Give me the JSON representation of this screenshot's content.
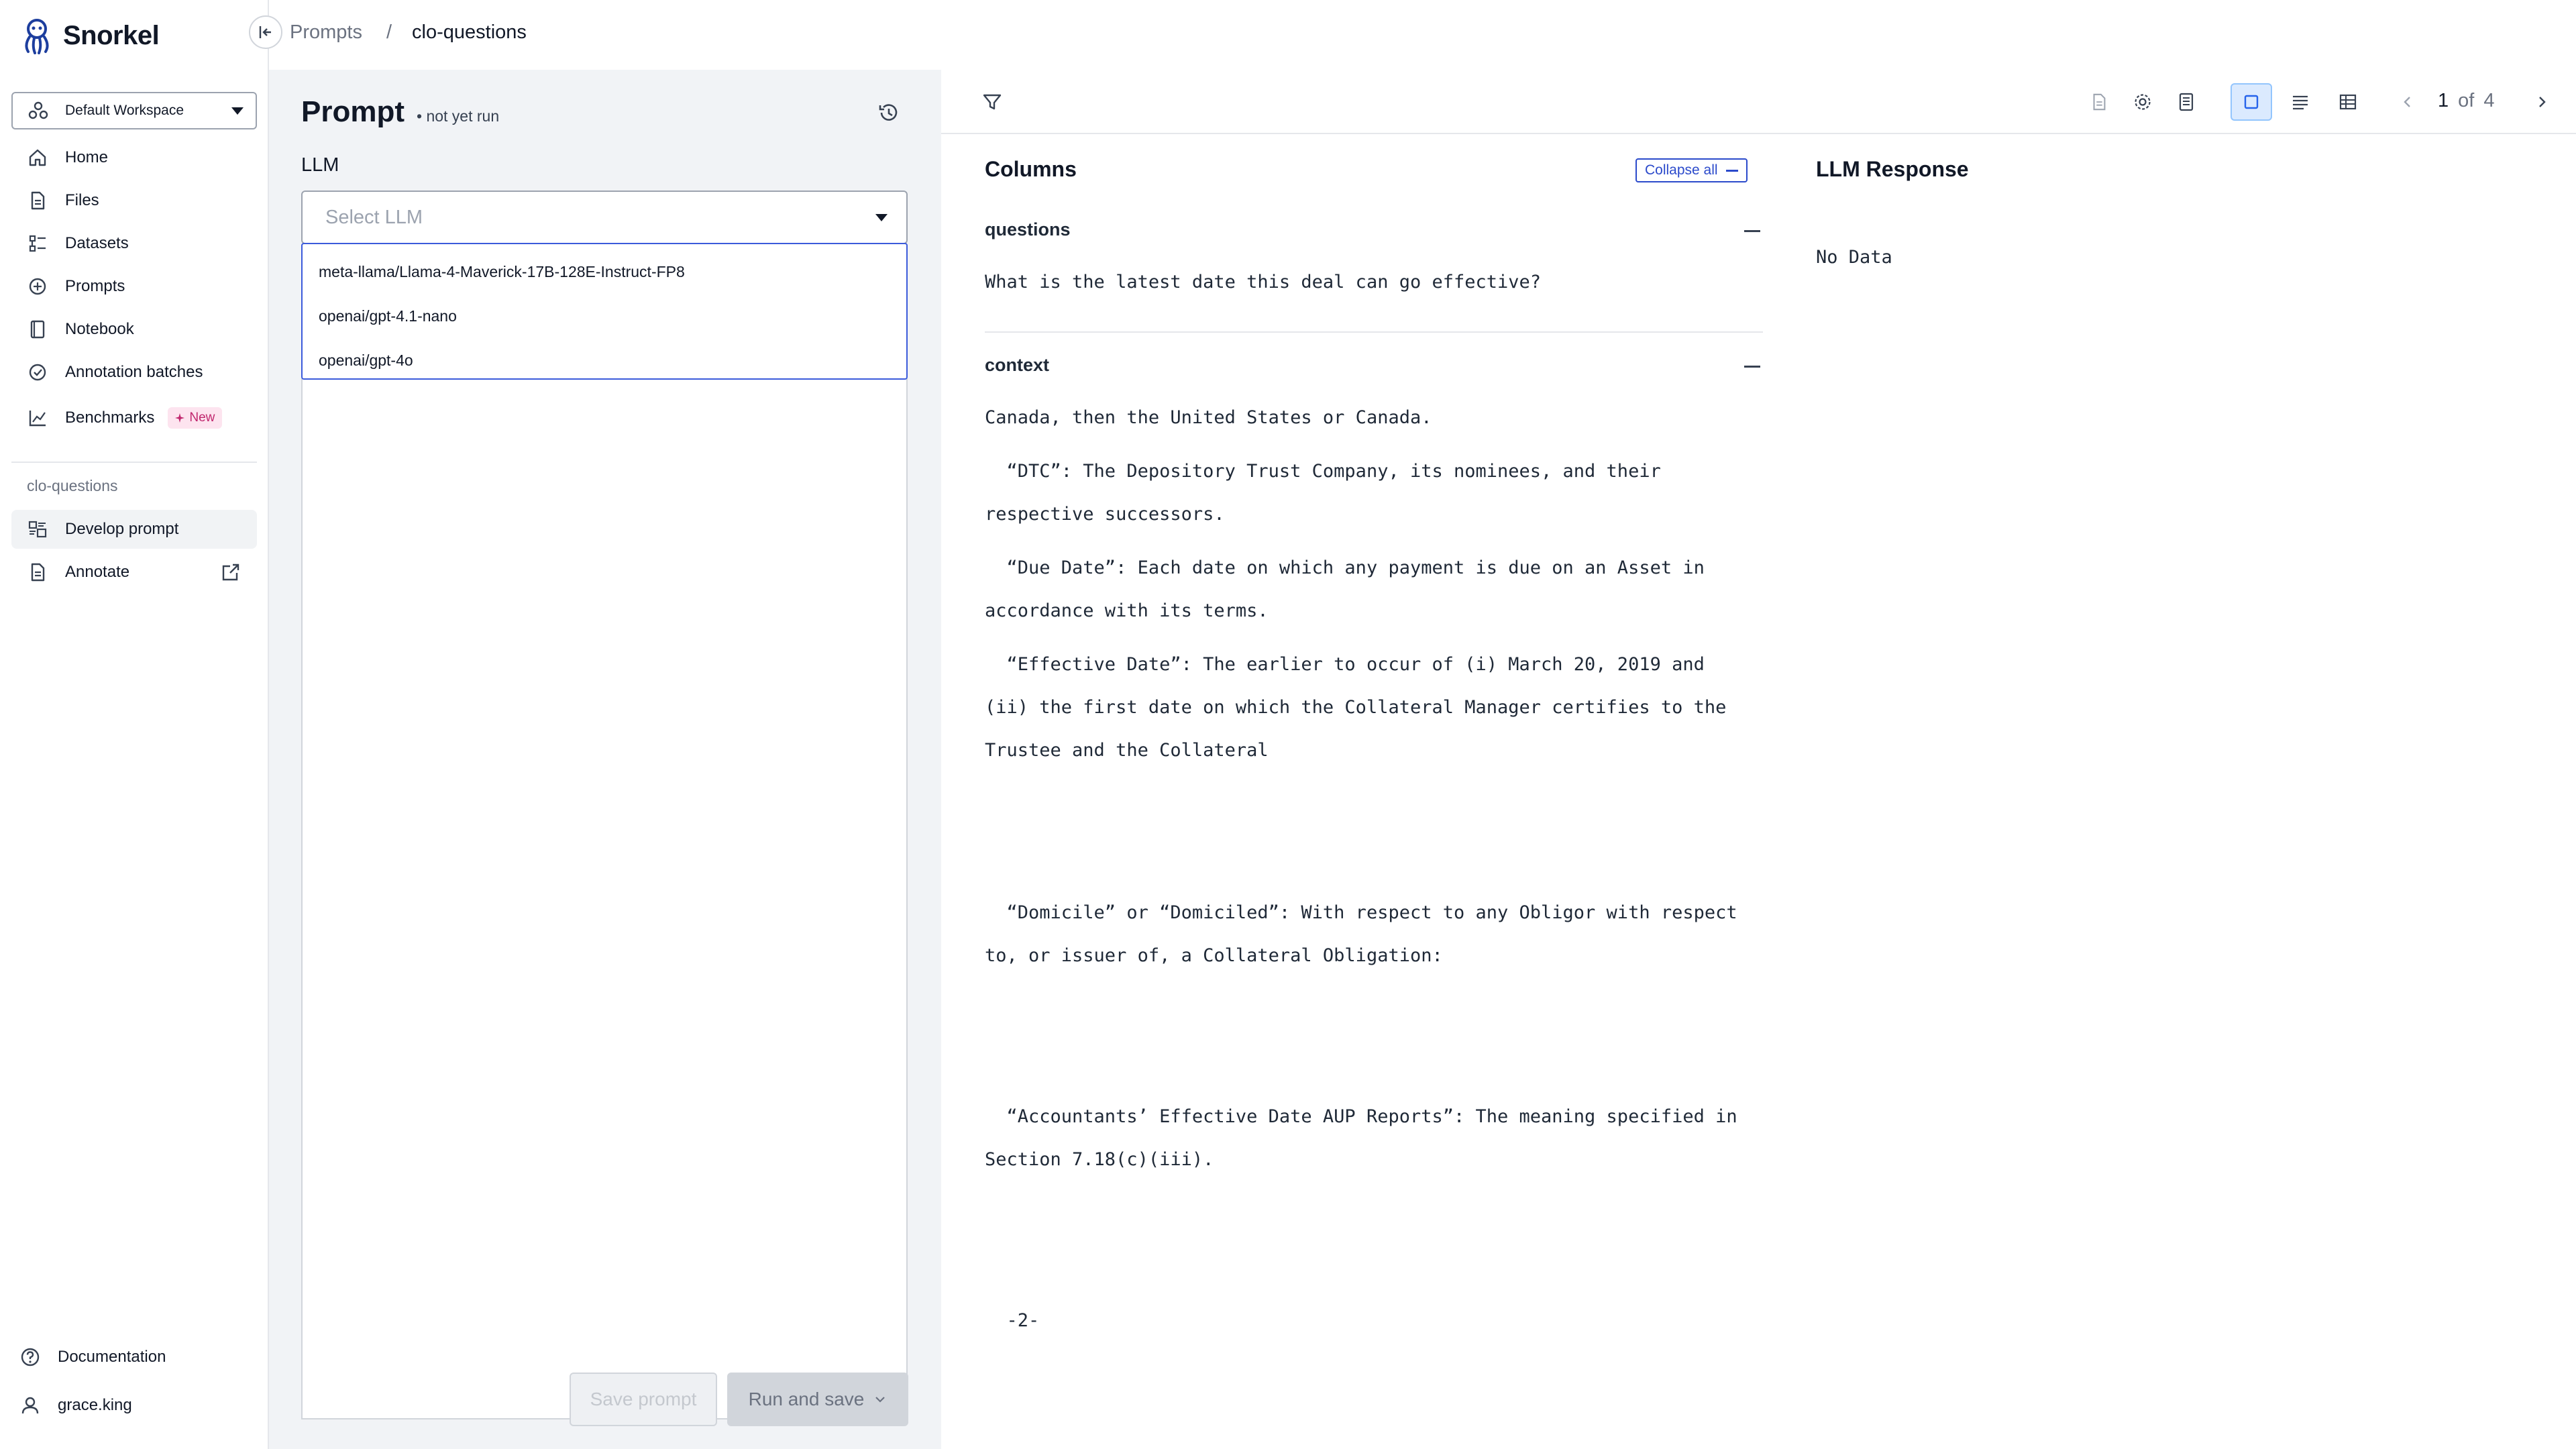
{
  "app": {
    "brand": "Snorkel"
  },
  "sidebar": {
    "workspace": "Default Workspace",
    "items": [
      {
        "label": "Home",
        "icon": "home-icon"
      },
      {
        "label": "Files",
        "icon": "file-icon"
      },
      {
        "label": "Datasets",
        "icon": "datasets-icon"
      },
      {
        "label": "Prompts",
        "icon": "prompts-icon"
      },
      {
        "label": "Notebook",
        "icon": "notebook-icon"
      },
      {
        "label": "Annotation batches",
        "icon": "check-circle-icon"
      },
      {
        "label": "Benchmarks",
        "icon": "chart-icon",
        "badge": "New"
      }
    ],
    "section_label": "clo-questions",
    "section_items": [
      {
        "label": "Develop prompt",
        "icon": "develop-icon",
        "active": true
      },
      {
        "label": "Annotate",
        "icon": "file-icon"
      }
    ],
    "bottom": {
      "documentation": "Documentation",
      "user": "grace.king"
    }
  },
  "breadcrumb": {
    "parent": "Prompts",
    "separator": "/",
    "current": "clo-questions"
  },
  "prompt": {
    "title": "Prompt",
    "status": "• not yet run",
    "llm_label": "LLM",
    "llm_placeholder": "Select LLM",
    "llm_options": [
      "meta-llama/Llama-4-Maverick-17B-128E-Instruct-FP8",
      "openai/gpt-4.1-nano",
      "openai/gpt-4o"
    ],
    "save_label": "Save prompt",
    "run_label": "Run and save"
  },
  "pager": {
    "current": "1",
    "of": "of",
    "total": "4"
  },
  "columns": {
    "header": "Columns",
    "collapse_all": "Collapse all",
    "questions_label": "questions",
    "question_text": "What is the latest date this deal can go effective?",
    "context_label": "context",
    "context_lines": [
      "Canada, then the United States or Canada.",
      "  “DTC”: The Depository Trust Company, its nominees, and their",
      "respective successors.",
      "  “Due Date”: Each date on which any payment is due on an Asset in",
      "accordance with its terms.",
      "  “Effective Date”: The earlier to occur of (i) March 20, 2019 and",
      "(ii) the first date on which the Collateral Manager certifies to the",
      "Trustee and the Collateral",
      "  “Domicile” or “Domiciled”: With respect to any Obligor with respect",
      "to, or issuer of, a Collateral Obligation:",
      "  “Accountants’ Effective Date AUP Reports”: The meaning specified in",
      "Section 7.18(c)(iii).",
      "  -2-"
    ]
  },
  "llm_response": {
    "header": "LLM Response",
    "value": "No Data"
  },
  "colors": {
    "accent": "#2b4acb",
    "badge_bg": "#fde4ef",
    "badge_text": "#c0266d",
    "panel_bg": "#f1f3f6"
  }
}
